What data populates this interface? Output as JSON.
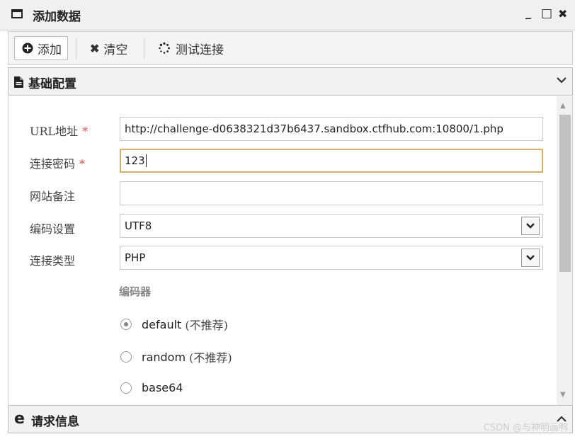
{
  "window": {
    "title": "添加数据",
    "minimize": "_",
    "maximize": "□",
    "close": "✖"
  },
  "toolbar": {
    "add_label": "添加",
    "clear_label": "清空",
    "test_label": "测试连接"
  },
  "sections": {
    "basic": "基础配置",
    "request": "请求信息"
  },
  "form": {
    "url": {
      "label": "URL地址",
      "required": "*",
      "value": "http://challenge-d0638321d37b6437.sandbox.ctfhub.com:10800/1.php"
    },
    "password": {
      "label": "连接密码",
      "required": "*",
      "value": "123"
    },
    "note": {
      "label": "网站备注",
      "value": ""
    },
    "encoding": {
      "label": "编码设置",
      "value": "UTF8"
    },
    "type": {
      "label": "连接类型",
      "value": "PHP"
    },
    "encoder": {
      "label": "编码器",
      "options": [
        {
          "name": "default",
          "note": "(不推荐)",
          "checked": true
        },
        {
          "name": "random",
          "note": "(不推荐)",
          "checked": false
        },
        {
          "name": "base64",
          "note": "",
          "checked": false
        }
      ]
    }
  },
  "watermark": "CSDN @与神明画鸭",
  "icons": [
    "window-icon",
    "plus-circle-icon",
    "times-icon",
    "spinner-icon",
    "file-icon",
    "chevron-down-icon",
    "ie-icon",
    "chevron-up-icon"
  ]
}
